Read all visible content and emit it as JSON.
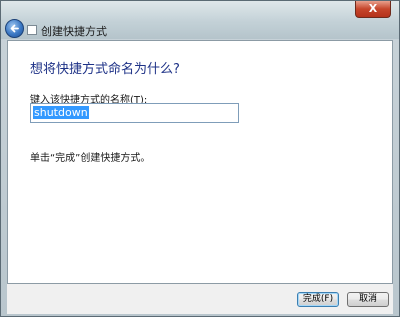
{
  "window": {
    "title": "创建快捷方式",
    "close_glyph": "X"
  },
  "content": {
    "heading": "想将快捷方式命名为什么?",
    "field_label": "键入该快捷方式的名称(T):",
    "name_value": "shutdown",
    "hint": "单击“完成”创建快捷方式。"
  },
  "buttons": {
    "finish_label": "完成(F)",
    "cancel_label": "取消"
  },
  "colors": {
    "heading": "#1e3287",
    "selection": "#3399ff",
    "close_button": "#c6452b"
  }
}
